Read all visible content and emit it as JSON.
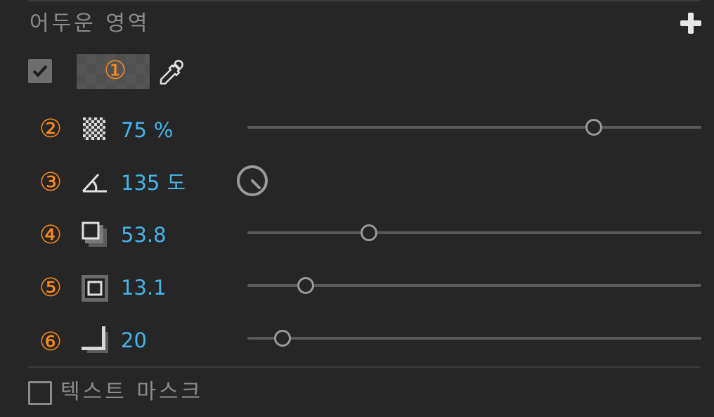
{
  "panel": {
    "section_title": "어두운 영역",
    "add_icon": "plus-icon",
    "color_row": {
      "enabled": true,
      "swatch_color": "#505050",
      "marker": "①",
      "eyedropper_icon": "eyedropper-icon"
    },
    "rows": [
      {
        "marker": "②",
        "icon": "opacity-checker-icon",
        "value": "75",
        "unit": "%",
        "slider_fraction": 0.763
      },
      {
        "marker": "③",
        "icon": "angle-icon",
        "value": "135",
        "unit": "도",
        "dial_degrees": 135
      },
      {
        "marker": "④",
        "icon": "distance-shadow-icon",
        "value": "53.8",
        "slider_fraction": 0.268
      },
      {
        "marker": "⑤",
        "icon": "spread-box-icon",
        "value": "13.1",
        "slider_fraction": 0.128
      },
      {
        "marker": "⑥",
        "icon": "size-corner-icon",
        "value": "20",
        "slider_fraction": 0.078
      }
    ],
    "text_mask": {
      "checked": false,
      "label": "텍스트 마스크"
    },
    "colors": {
      "accent_marker": "#ff8c1a",
      "value_blue": "#45b5ec"
    }
  }
}
